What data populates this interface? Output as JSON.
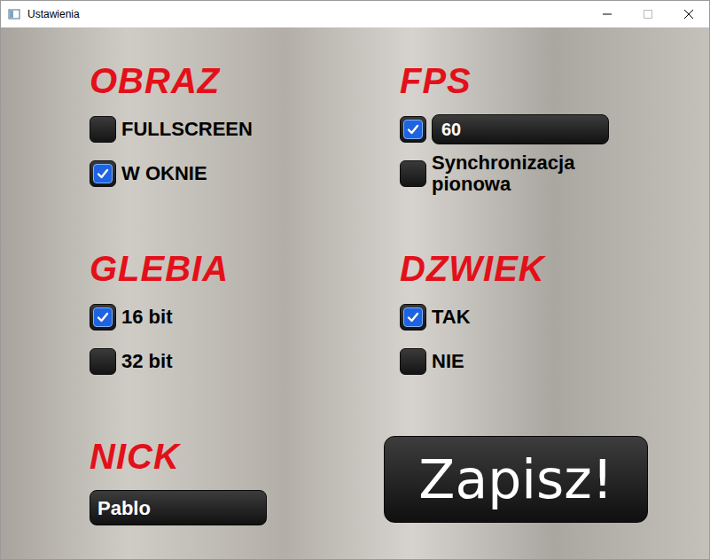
{
  "window": {
    "title": "Ustawienia"
  },
  "sections": [
    {
      "title": "OBRAZ",
      "items": [
        {
          "kind": "checkbox",
          "label": "FULLSCREEN",
          "checked": false
        },
        {
          "kind": "checkbox",
          "label": "W OKNIE",
          "checked": true
        }
      ]
    },
    {
      "title": "FPS",
      "items": [
        {
          "kind": "checkbox-field",
          "value": "60",
          "checked": true
        },
        {
          "kind": "checkbox",
          "label": "Synchronizacja pionowa",
          "checked": false
        }
      ]
    },
    {
      "title": "GLEBIA",
      "items": [
        {
          "kind": "checkbox",
          "label": "16 bit",
          "checked": true
        },
        {
          "kind": "checkbox",
          "label": "32 bit",
          "checked": false
        }
      ]
    },
    {
      "title": "DZWIEK",
      "items": [
        {
          "kind": "checkbox",
          "label": "TAK",
          "checked": true
        },
        {
          "kind": "checkbox",
          "label": "NIE",
          "checked": false
        }
      ]
    }
  ],
  "nick": {
    "title": "NICK",
    "value": "Pablo"
  },
  "buttons": [
    "Zapisz!"
  ]
}
